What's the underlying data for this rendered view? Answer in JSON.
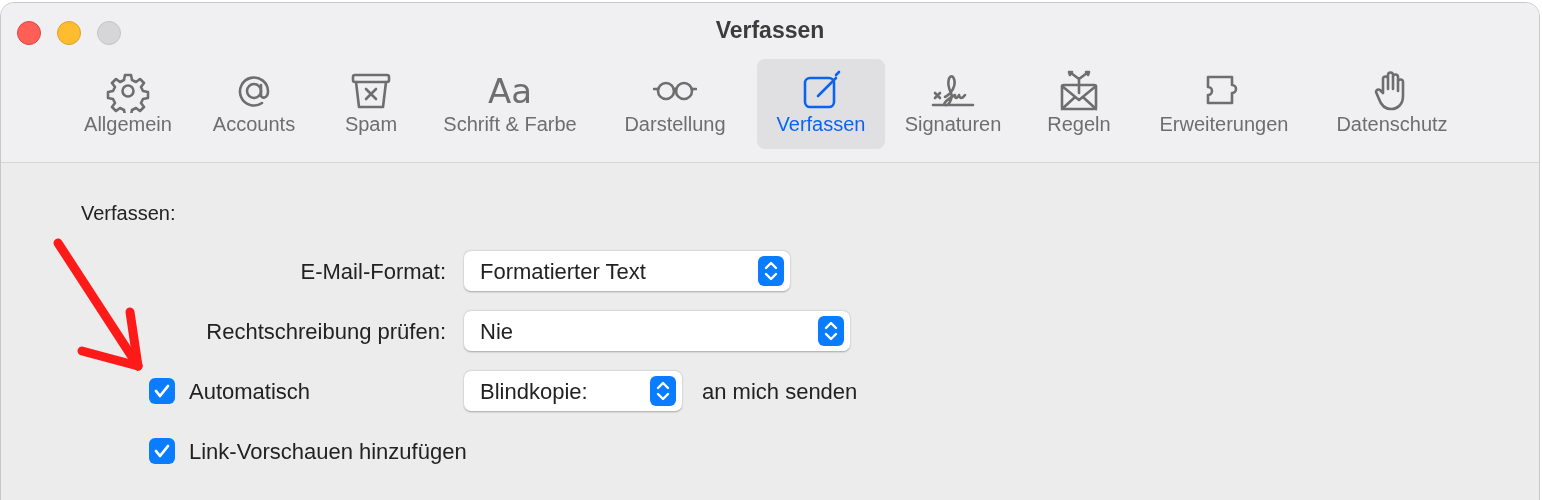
{
  "window": {
    "title": "Verfassen"
  },
  "toolbar": [
    {
      "label": "Allgemein",
      "selected": false
    },
    {
      "label": "Accounts",
      "selected": false
    },
    {
      "label": "Spam",
      "selected": false
    },
    {
      "label": "Schrift & Farbe",
      "selected": false,
      "glyph": "Aa"
    },
    {
      "label": "Darstellung",
      "selected": false
    },
    {
      "label": "Verfassen",
      "selected": true
    },
    {
      "label": "Signaturen",
      "selected": false
    },
    {
      "label": "Regeln",
      "selected": false
    },
    {
      "label": "Erweiterungen",
      "selected": false
    },
    {
      "label": "Datenschutz",
      "selected": false
    }
  ],
  "section_title": "Verfassen:",
  "settings": [
    {
      "kind": "popup",
      "label": "E-Mail-Format:",
      "value": "Formatierter Text"
    },
    {
      "kind": "popup",
      "label": "Rechtschreibung prüfen:",
      "value": "Nie"
    },
    {
      "kind": "checkbox_popup",
      "label": "Automatisch",
      "checked": true,
      "value": "Blindkopie:",
      "suffix": "an mich senden"
    },
    {
      "kind": "checkbox",
      "label": "Link-Vorschauen hinzufügen",
      "checked": true
    }
  ]
}
